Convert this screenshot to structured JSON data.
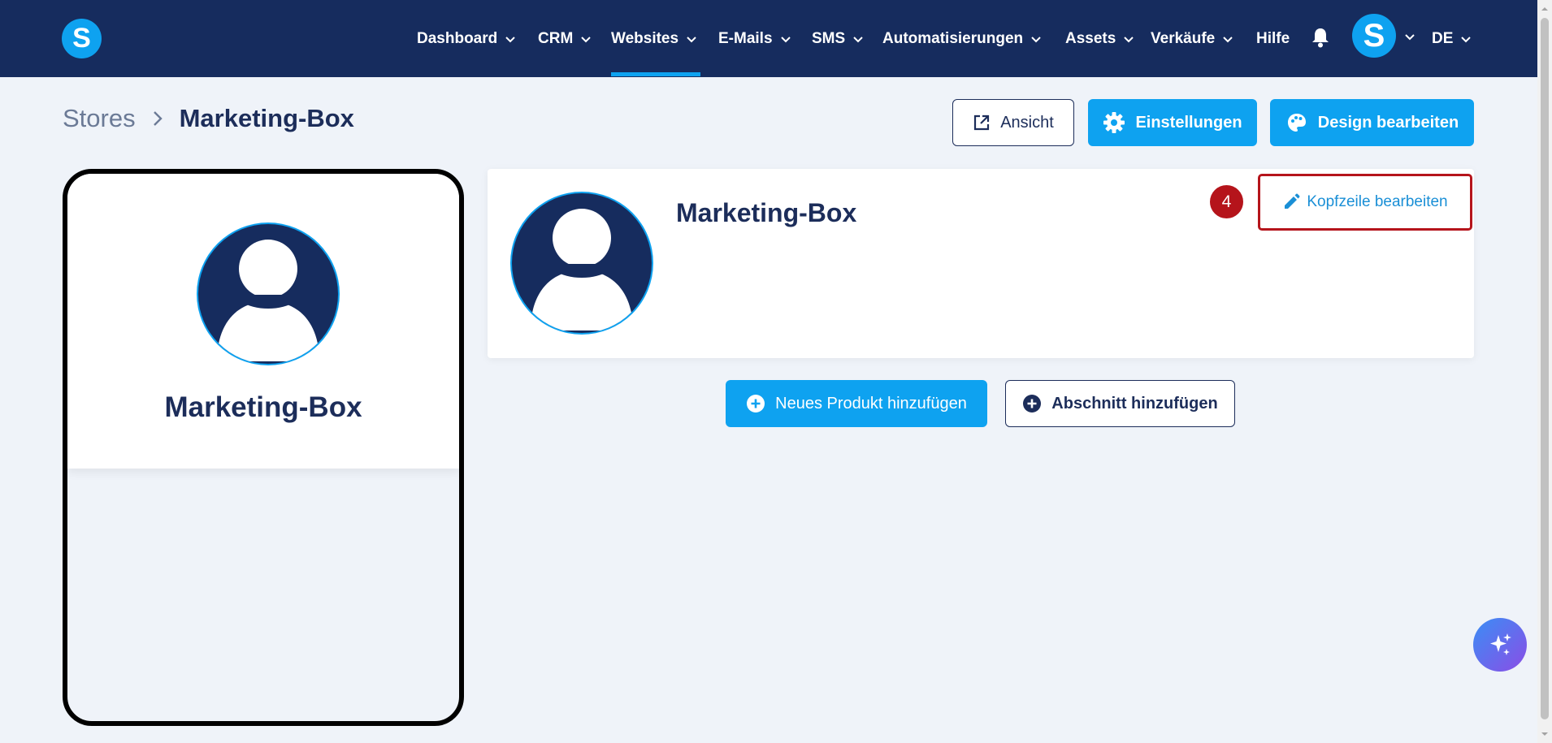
{
  "app": {
    "logo_letter": "S"
  },
  "nav": {
    "items": [
      {
        "label": "Dashboard"
      },
      {
        "label": "CRM"
      },
      {
        "label": "Websites"
      },
      {
        "label": "E-Mails"
      },
      {
        "label": "SMS"
      },
      {
        "label": "Automatisierungen"
      },
      {
        "label": "Assets"
      },
      {
        "label": "Verkäufe"
      },
      {
        "label": "Hilfe"
      }
    ],
    "active": "Websites",
    "avatar_letter": "S",
    "language": "DE"
  },
  "breadcrumb": {
    "parent": "Stores",
    "current": "Marketing-Box"
  },
  "toolbar": {
    "view_label": "Ansicht",
    "settings_label": "Einstellungen",
    "design_label": "Design bearbeiten"
  },
  "preview": {
    "title": "Marketing-Box"
  },
  "store_header": {
    "title": "Marketing-Box",
    "step_badge": "4",
    "edit_label": "Kopfzeile bearbeiten"
  },
  "actions": {
    "add_product_label": "Neues Produkt hinzufügen",
    "add_section_label": "Abschnitt hinzufügen"
  },
  "colors": {
    "topbar": "#162c5e",
    "accent": "#0ea2f0",
    "highlight": "#b5141b",
    "text_dark": "#1c2d5a"
  },
  "icons": {
    "nav_chevron": "chevron-down-icon",
    "bell": "bell-icon",
    "view": "external-link-icon",
    "settings": "gear-icon",
    "design": "palette-icon",
    "edit": "pencil-icon",
    "add": "plus-circle-icon",
    "ai": "sparkles-icon"
  }
}
